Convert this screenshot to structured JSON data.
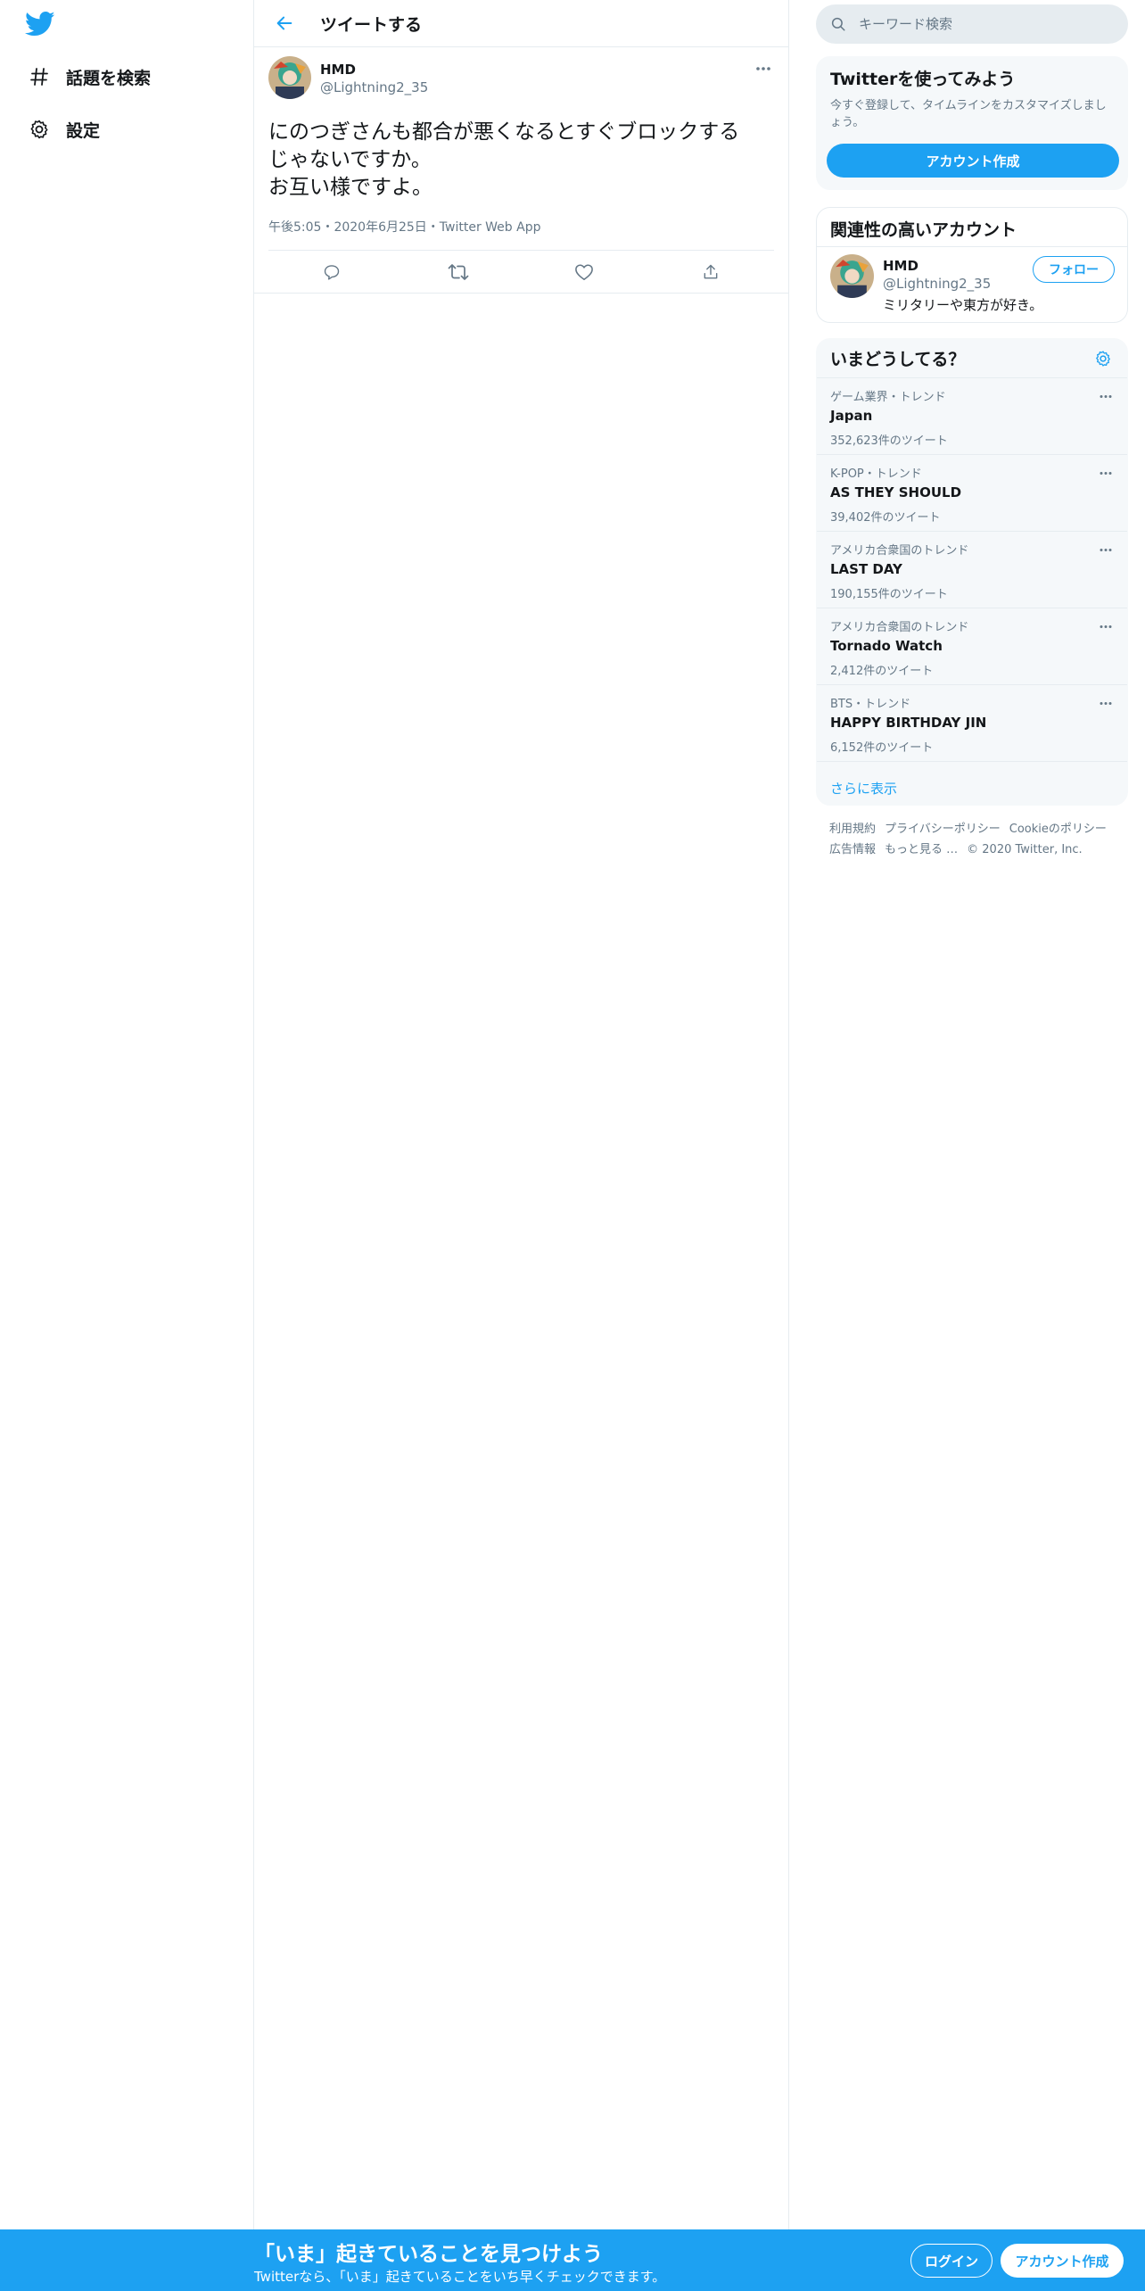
{
  "colors": {
    "accent": "#1da1f2",
    "text": "#14171a",
    "muted": "#657786",
    "border": "#e6ecf0"
  },
  "nav": {
    "logo_icon": "twitter-bird-icon",
    "items": [
      {
        "icon": "hashtag-icon",
        "label": "話題を検索"
      },
      {
        "icon": "gear-icon",
        "label": "設定"
      }
    ]
  },
  "header": {
    "back_icon": "arrow-left-icon",
    "title": "ツイートする"
  },
  "tweet": {
    "display_name": "HMD",
    "handle": "@Lightning2_35",
    "text_lines": [
      "にのつぎさんも都合が悪くなるとすぐブロックする",
      "じゃないですか。",
      "お互い様ですよ。"
    ],
    "meta": "午後5:05・2020年6月25日・Twitter Web App",
    "actions": [
      "reply-icon",
      "retweet-icon",
      "like-icon",
      "share-icon"
    ]
  },
  "search": {
    "placeholder": "キーワード検索"
  },
  "try_twitter": {
    "title": "Twitterを使ってみよう",
    "desc": "今すぐ登録して、タイムラインをカスタマイズしましょう。",
    "button": "アカウント作成"
  },
  "related": {
    "title": "関連性の高いアカウント",
    "user": {
      "name": "HMD",
      "handle": "@Lightning2_35",
      "bio": "ミリタリーや東方が好き。",
      "follow": "フォロー"
    }
  },
  "trends": {
    "title": "いまどうしてる？",
    "items": [
      {
        "context": "ゲーム業界・トレンド",
        "name": "Japan",
        "count": "352,623件のツイート"
      },
      {
        "context": "K-POP・トレンド",
        "name": "AS THEY SHOULD",
        "count": "39,402件のツイート"
      },
      {
        "context": "アメリカ合衆国のトレンド",
        "name": "LAST DAY",
        "count": "190,155件のツイート"
      },
      {
        "context": "アメリカ合衆国のトレンド",
        "name": "Tornado Watch",
        "count": "2,412件のツイート"
      },
      {
        "context": "BTS・トレンド",
        "name": "HAPPY BIRTHDAY JIN",
        "count": "6,152件のツイート"
      }
    ],
    "show_more": "さらに表示"
  },
  "footer": {
    "links": [
      "利用規約",
      "プライバシーポリシー",
      "Cookieのポリシー",
      "広告情報",
      "もっと見る …"
    ],
    "copyright": "© 2020 Twitter, Inc."
  },
  "bottom_bar": {
    "title": "「いま」起きていることを見つけよう",
    "subtitle": "Twitterなら、「いま」起きていることをいち早くチェックできます。",
    "login": "ログイン",
    "signup": "アカウント作成"
  }
}
